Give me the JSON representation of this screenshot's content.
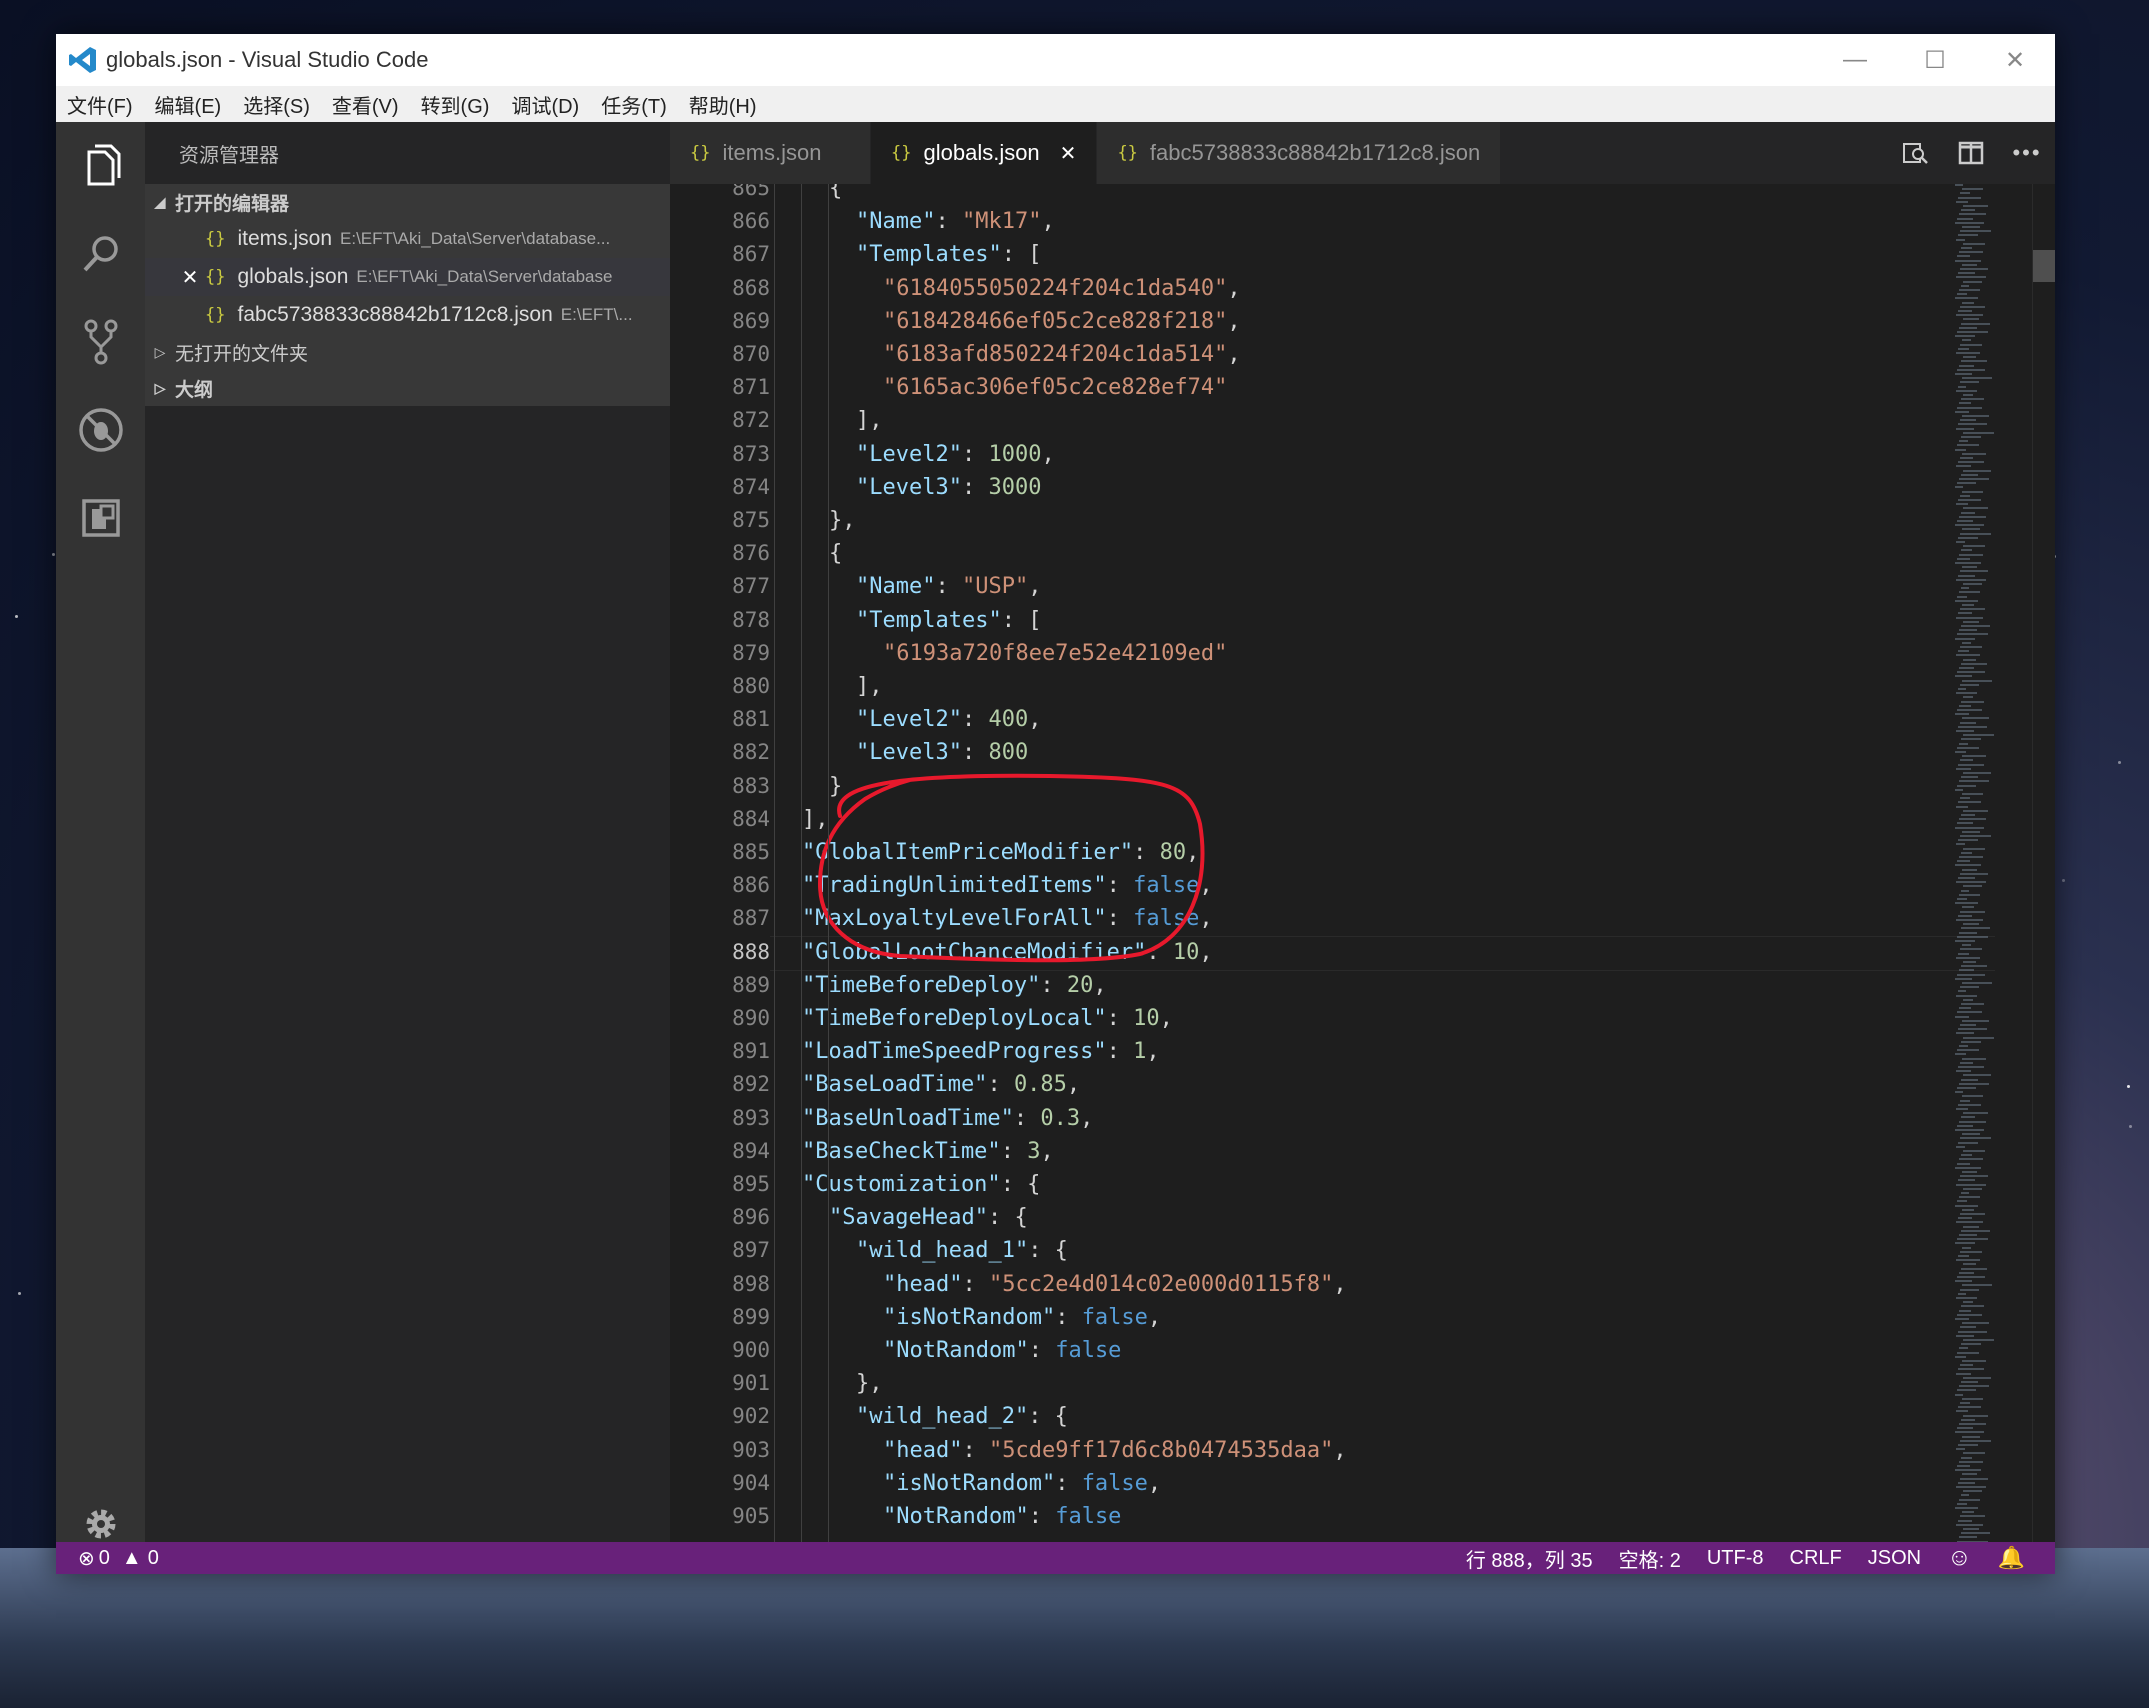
{
  "window": {
    "title": "globals.json - Visual Studio Code",
    "controls": [
      "—",
      "☐",
      "✕"
    ]
  },
  "menu": [
    "文件(F)",
    "编辑(E)",
    "选择(S)",
    "查看(V)",
    "转到(G)",
    "调试(D)",
    "任务(T)",
    "帮助(H)"
  ],
  "sidebar": {
    "title": "资源管理器",
    "open_editors_label": "打开的编辑器",
    "open_editors": [
      {
        "name": "items.json",
        "path": "E:\\EFT\\Aki_Data\\Server\\database..."
      },
      {
        "name": "globals.json",
        "path": "E:\\EFT\\Aki_Data\\Server\\database"
      },
      {
        "name": "fabc5738833c88842b1712c8.json",
        "path": "E:\\EFT\\..."
      }
    ],
    "no_folder_label": "无打开的文件夹",
    "outline_label": "大纲"
  },
  "tabs": [
    {
      "name": "items.json"
    },
    {
      "name": "globals.json",
      "active": true,
      "close": "✕"
    },
    {
      "name": "fabc5738833c88842b1712c8.json"
    }
  ],
  "editor": {
    "current_line": 888,
    "lines": [
      {
        "n": "865",
        "indent": 1,
        "parts": [
          [
            "p",
            "{"
          ]
        ]
      },
      {
        "n": "866",
        "indent": 2,
        "parts": [
          [
            "k",
            "\"Name\""
          ],
          [
            "p",
            ": "
          ],
          [
            "s",
            "\"Mk17\""
          ],
          [
            "p",
            ","
          ]
        ]
      },
      {
        "n": "867",
        "indent": 2,
        "parts": [
          [
            "k",
            "\"Templates\""
          ],
          [
            "p",
            ": ["
          ]
        ]
      },
      {
        "n": "868",
        "indent": 3,
        "parts": [
          [
            "s",
            "\"6184055050224f204c1da540\""
          ],
          [
            "p",
            ","
          ]
        ]
      },
      {
        "n": "869",
        "indent": 3,
        "parts": [
          [
            "s",
            "\"618428466ef05c2ce828f218\""
          ],
          [
            "p",
            ","
          ]
        ]
      },
      {
        "n": "870",
        "indent": 3,
        "parts": [
          [
            "s",
            "\"6183afd850224f204c1da514\""
          ],
          [
            "p",
            ","
          ]
        ]
      },
      {
        "n": "871",
        "indent": 3,
        "parts": [
          [
            "s",
            "\"6165ac306ef05c2ce828ef74\""
          ]
        ]
      },
      {
        "n": "872",
        "indent": 2,
        "parts": [
          [
            "p",
            "],"
          ]
        ]
      },
      {
        "n": "873",
        "indent": 2,
        "parts": [
          [
            "k",
            "\"Level2\""
          ],
          [
            "p",
            ": "
          ],
          [
            "n",
            "1000"
          ],
          [
            "p",
            ","
          ]
        ]
      },
      {
        "n": "874",
        "indent": 2,
        "parts": [
          [
            "k",
            "\"Level3\""
          ],
          [
            "p",
            ": "
          ],
          [
            "n",
            "3000"
          ]
        ]
      },
      {
        "n": "875",
        "indent": 1,
        "parts": [
          [
            "p",
            "},"
          ]
        ]
      },
      {
        "n": "876",
        "indent": 1,
        "parts": [
          [
            "p",
            "{"
          ]
        ]
      },
      {
        "n": "877",
        "indent": 2,
        "parts": [
          [
            "k",
            "\"Name\""
          ],
          [
            "p",
            ": "
          ],
          [
            "s",
            "\"USP\""
          ],
          [
            "p",
            ","
          ]
        ]
      },
      {
        "n": "878",
        "indent": 2,
        "parts": [
          [
            "k",
            "\"Templates\""
          ],
          [
            "p",
            ": ["
          ]
        ]
      },
      {
        "n": "879",
        "indent": 3,
        "parts": [
          [
            "s",
            "\"6193a720f8ee7e52e42109ed\""
          ]
        ]
      },
      {
        "n": "880",
        "indent": 2,
        "parts": [
          [
            "p",
            "],"
          ]
        ]
      },
      {
        "n": "881",
        "indent": 2,
        "parts": [
          [
            "k",
            "\"Level2\""
          ],
          [
            "p",
            ": "
          ],
          [
            "n",
            "400"
          ],
          [
            "p",
            ","
          ]
        ]
      },
      {
        "n": "882",
        "indent": 2,
        "parts": [
          [
            "k",
            "\"Level3\""
          ],
          [
            "p",
            ": "
          ],
          [
            "n",
            "800"
          ]
        ]
      },
      {
        "n": "883",
        "indent": 1,
        "parts": [
          [
            "p",
            "}"
          ]
        ]
      },
      {
        "n": "884",
        "indent": 0,
        "parts": [
          [
            "p",
            "],"
          ]
        ]
      },
      {
        "n": "885",
        "indent": 0,
        "parts": [
          [
            "k",
            "\"GlobalItemPriceModifier\""
          ],
          [
            "p",
            ": "
          ],
          [
            "n",
            "80"
          ],
          [
            "p",
            ","
          ]
        ]
      },
      {
        "n": "886",
        "indent": 0,
        "parts": [
          [
            "k",
            "\"TradingUnlimitedItems\""
          ],
          [
            "p",
            ": "
          ],
          [
            "b",
            "false"
          ],
          [
            "p",
            ","
          ]
        ]
      },
      {
        "n": "887",
        "indent": 0,
        "parts": [
          [
            "k",
            "\"MaxLoyaltyLevelForAll\""
          ],
          [
            "p",
            ": "
          ],
          [
            "b",
            "false"
          ],
          [
            "p",
            ","
          ]
        ]
      },
      {
        "n": "888",
        "indent": 0,
        "parts": [
          [
            "k",
            "\"GlobalLootChanceModifier\""
          ],
          [
            "p",
            ": "
          ],
          [
            "n",
            "10"
          ],
          [
            "p",
            ","
          ]
        ]
      },
      {
        "n": "889",
        "indent": 0,
        "parts": [
          [
            "k",
            "\"TimeBeforeDeploy\""
          ],
          [
            "p",
            ": "
          ],
          [
            "n",
            "20"
          ],
          [
            "p",
            ","
          ]
        ]
      },
      {
        "n": "890",
        "indent": 0,
        "parts": [
          [
            "k",
            "\"TimeBeforeDeployLocal\""
          ],
          [
            "p",
            ": "
          ],
          [
            "n",
            "10"
          ],
          [
            "p",
            ","
          ]
        ]
      },
      {
        "n": "891",
        "indent": 0,
        "parts": [
          [
            "k",
            "\"LoadTimeSpeedProgress\""
          ],
          [
            "p",
            ": "
          ],
          [
            "n",
            "1"
          ],
          [
            "p",
            ","
          ]
        ]
      },
      {
        "n": "892",
        "indent": 0,
        "parts": [
          [
            "k",
            "\"BaseLoadTime\""
          ],
          [
            "p",
            ": "
          ],
          [
            "n",
            "0.85"
          ],
          [
            "p",
            ","
          ]
        ]
      },
      {
        "n": "893",
        "indent": 0,
        "parts": [
          [
            "k",
            "\"BaseUnloadTime\""
          ],
          [
            "p",
            ": "
          ],
          [
            "n",
            "0.3"
          ],
          [
            "p",
            ","
          ]
        ]
      },
      {
        "n": "894",
        "indent": 0,
        "parts": [
          [
            "k",
            "\"BaseCheckTime\""
          ],
          [
            "p",
            ": "
          ],
          [
            "n",
            "3"
          ],
          [
            "p",
            ","
          ]
        ]
      },
      {
        "n": "895",
        "indent": 0,
        "parts": [
          [
            "k",
            "\"Customization\""
          ],
          [
            "p",
            ": {"
          ]
        ]
      },
      {
        "n": "896",
        "indent": 1,
        "parts": [
          [
            "k",
            "\"SavageHead\""
          ],
          [
            "p",
            ": {"
          ]
        ]
      },
      {
        "n": "897",
        "indent": 2,
        "parts": [
          [
            "k",
            "\"wild_head_1\""
          ],
          [
            "p",
            ": {"
          ]
        ]
      },
      {
        "n": "898",
        "indent": 3,
        "parts": [
          [
            "k",
            "\"head\""
          ],
          [
            "p",
            ": "
          ],
          [
            "s",
            "\"5cc2e4d014c02e000d0115f8\""
          ],
          [
            "p",
            ","
          ]
        ]
      },
      {
        "n": "899",
        "indent": 3,
        "parts": [
          [
            "k",
            "\"isNotRandom\""
          ],
          [
            "p",
            ": "
          ],
          [
            "b",
            "false"
          ],
          [
            "p",
            ","
          ]
        ]
      },
      {
        "n": "900",
        "indent": 3,
        "parts": [
          [
            "k",
            "\"NotRandom\""
          ],
          [
            "p",
            ": "
          ],
          [
            "b",
            "false"
          ]
        ]
      },
      {
        "n": "901",
        "indent": 2,
        "parts": [
          [
            "p",
            "},"
          ]
        ]
      },
      {
        "n": "902",
        "indent": 2,
        "parts": [
          [
            "k",
            "\"wild_head_2\""
          ],
          [
            "p",
            ": {"
          ]
        ]
      },
      {
        "n": "903",
        "indent": 3,
        "parts": [
          [
            "k",
            "\"head\""
          ],
          [
            "p",
            ": "
          ],
          [
            "s",
            "\"5cde9ff17d6c8b0474535daa\""
          ],
          [
            "p",
            ","
          ]
        ]
      },
      {
        "n": "904",
        "indent": 3,
        "parts": [
          [
            "k",
            "\"isNotRandom\""
          ],
          [
            "p",
            ": "
          ],
          [
            "b",
            "false"
          ],
          [
            "p",
            ","
          ]
        ]
      },
      {
        "n": "905",
        "indent": 3,
        "parts": [
          [
            "k",
            "\"NotRandom\""
          ],
          [
            "p",
            ": "
          ],
          [
            "b",
            "false"
          ]
        ]
      }
    ]
  },
  "status": {
    "errors": "0",
    "warnings": "0",
    "position": "行 888，列 35",
    "spaces": "空格: 2",
    "encoding": "UTF-8",
    "eol": "CRLF",
    "language": "JSON"
  },
  "colors": {
    "statusbar": "#68217a",
    "annotation": "#e8192c",
    "key": "#9cdcfe",
    "string": "#ce9178",
    "number": "#b5cea8",
    "boolean": "#569cd6"
  },
  "icons": {
    "activity": [
      "files-icon",
      "search-icon",
      "source-control-icon",
      "debug-icon",
      "extensions-icon",
      "gear-icon"
    ]
  }
}
